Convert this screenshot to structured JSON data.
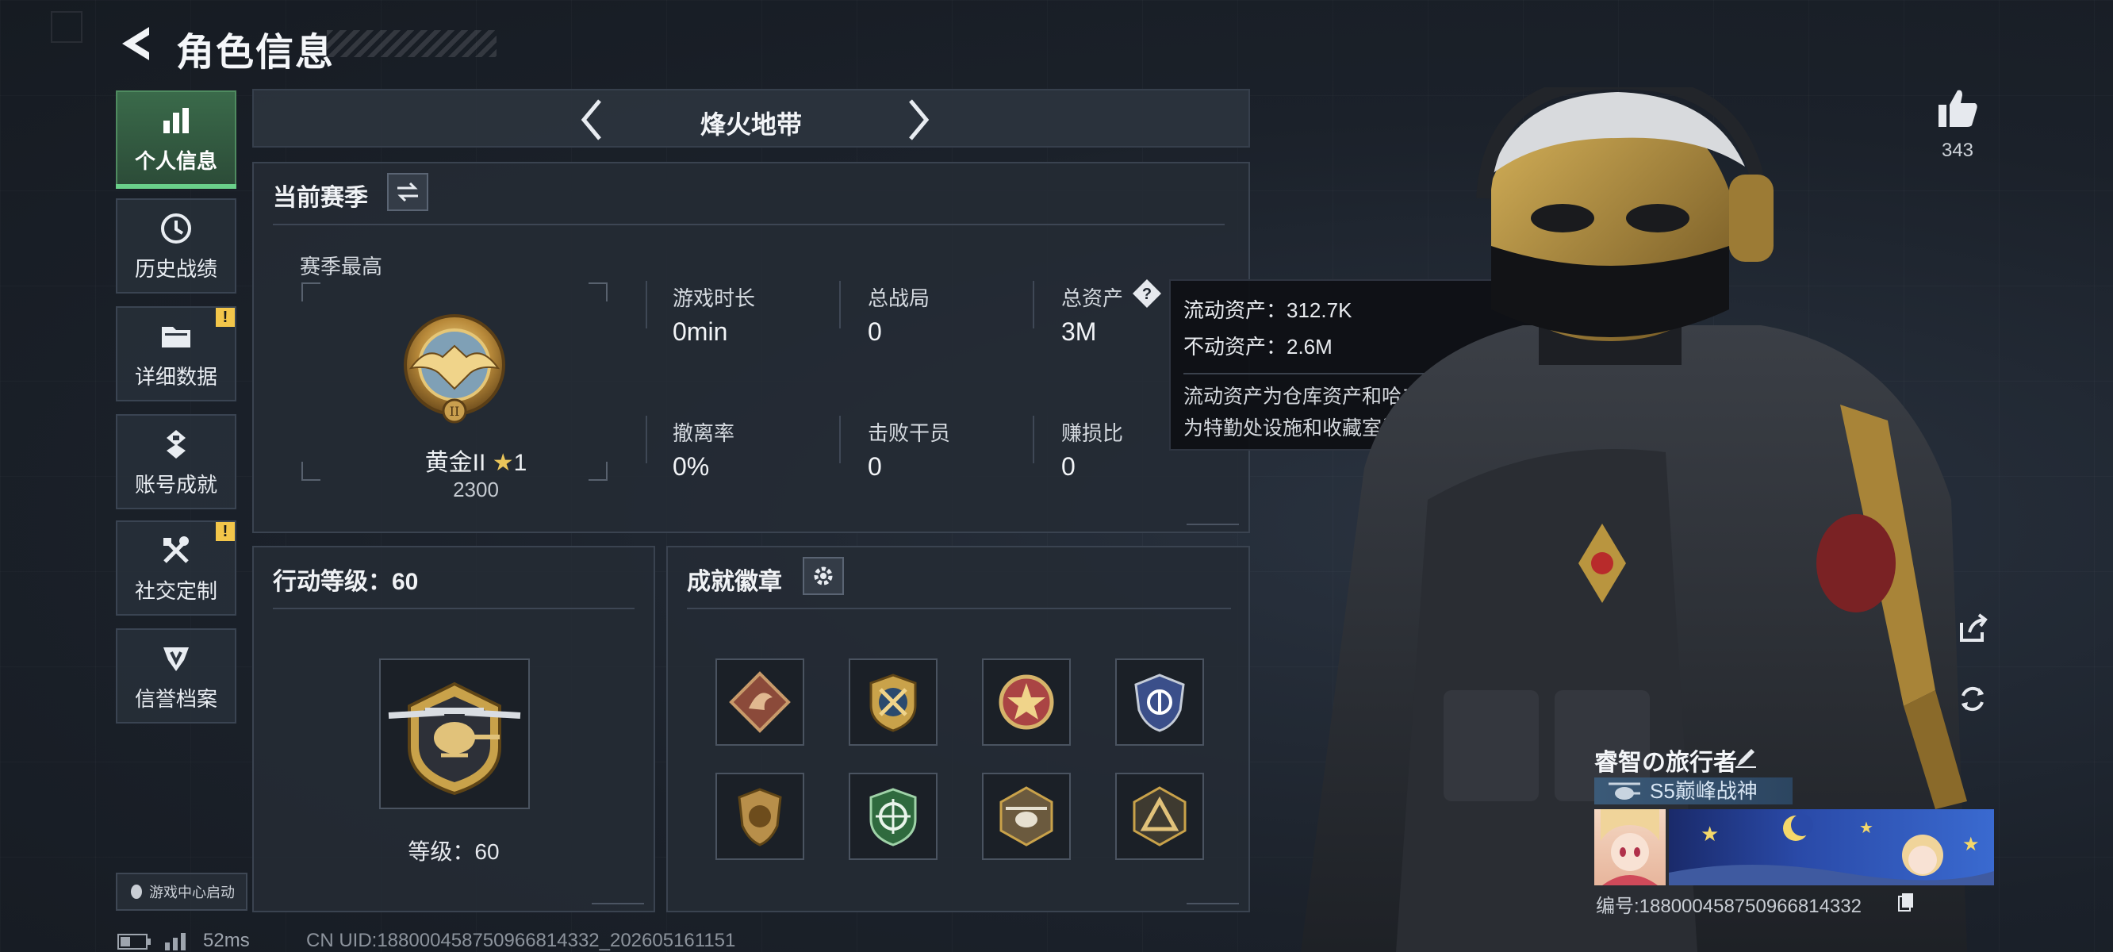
{
  "header": {
    "title": "角色信息"
  },
  "nav": {
    "items": [
      {
        "label": "个人信息",
        "active": true,
        "badge": ""
      },
      {
        "label": "历史战绩",
        "active": false,
        "badge": ""
      },
      {
        "label": "详细数据",
        "active": false,
        "badge": "!"
      },
      {
        "label": "账号成就",
        "active": false,
        "badge": ""
      },
      {
        "label": "社交定制",
        "active": false,
        "badge": "!"
      },
      {
        "label": "信誉档案",
        "active": false,
        "badge": ""
      }
    ]
  },
  "mode": {
    "title": "烽火地带"
  },
  "season": {
    "title": "当前赛季",
    "best_label": "赛季最高",
    "rank_name": "黄金II",
    "rank_stars": "1",
    "rank_score": "2300",
    "stats": [
      {
        "label": "游戏时长",
        "value": "0min"
      },
      {
        "label": "总战局",
        "value": "0"
      },
      {
        "label": "总资产",
        "value": "3M"
      },
      {
        "label": "撤离率",
        "value": "0%"
      },
      {
        "label": "击败干员",
        "value": "0"
      },
      {
        "label": "赚损比",
        "value": "0"
      }
    ]
  },
  "tooltip": {
    "liquid": "流动资产：312.7K",
    "fixed": "不动资产：2.6M",
    "desc_line1": "流动资产为仓库资产和哈夫币，不动资产",
    "desc_line2": "为特勤处设施和收藏室设施"
  },
  "level": {
    "title": "行动等级：60",
    "label": "等级：60"
  },
  "achievements": {
    "title": "成就徽章"
  },
  "social": {
    "likes": "343"
  },
  "player": {
    "name": "睿智の旅行者",
    "title": "S5巅峰战神",
    "id": "编号:188000458750966814332"
  },
  "footer": {
    "launch_label": "游戏中心启动",
    "ping": "52ms",
    "uid": "CN UID:188000458750966814332_202605161151"
  },
  "colors": {
    "accent_green": "#4f8b60",
    "gold": "#c9a24a",
    "warning": "#f3c64a"
  }
}
